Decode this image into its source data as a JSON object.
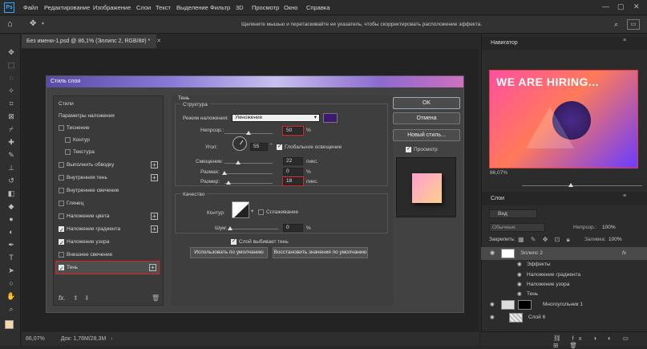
{
  "menu": [
    "Файл",
    "Редактирование",
    "Изображение",
    "Слои",
    "Текст",
    "Выделение",
    "Фильтр",
    "3D",
    "Просмотр",
    "Окно",
    "Справка"
  ],
  "options_hint": "Щелкните мышью и перетаскивайте ее указатель, чтобы скорректировать расположение эффекта.",
  "doc_tab": "Без имени-1.psd @ 86,1% (Эллипс 2, RGB/8#) *",
  "status": {
    "zoom": "86,07%",
    "doc": "Док: 1,76М/28,3M"
  },
  "navigator": {
    "title": "Навигатор",
    "thumb_text": "WE ARE HIRING...",
    "zoom": "86,07%"
  },
  "layers_panel": {
    "title": "Слои",
    "kind": "Вид",
    "blend": "Обычные",
    "opacity_label": "Непрозр.:",
    "opacity": "100%",
    "lock_label": "Закрепить:",
    "fill_label": "Заливка:",
    "fill": "100%",
    "layers": [
      "Эллипс 2",
      "Эффекты",
      "Наложение градиента",
      "Наложение узора",
      "Тень",
      "Многоугольник 1",
      "Слой 6"
    ]
  },
  "dialog": {
    "title": "Стиль слоя",
    "styles": [
      "Стили",
      "Параметры наложения",
      "Тиснение",
      "Контур",
      "Текстура",
      "Выполнить обводку",
      "Внутренняя тень",
      "Внутреннее свечение",
      "Глянец",
      "Наложение цвета",
      "Наложение градиента",
      "Наложение узора",
      "Внешнее свечение",
      "Тень"
    ],
    "section": "Тень",
    "structure": "Структура",
    "blend_mode_label": "Режим наложения:",
    "blend_mode": "Умножение",
    "shadow_color": "#3d1a6e",
    "opacity_label": "Непрозр.:",
    "opacity": "50",
    "angle_label": "Угол:",
    "angle": "55",
    "global_light": "Глобальное освещение",
    "distance_label": "Смещение:",
    "distance": "22",
    "spread_label": "Размах:",
    "spread": "0",
    "size_label": "Размер:",
    "size": "18",
    "unit_px": "пикс.",
    "unit_pct": "%",
    "unit_deg": "°",
    "quality": "Качество",
    "contour_label": "Контур:",
    "antialias": "Сглаживание",
    "noise_label": "Шум:",
    "noise": "0",
    "knockout": "Слой выбивает тень",
    "make_default": "Использовать по умолчанию",
    "reset_default": "Восстановить значения по умолчанию",
    "ok": "OK",
    "cancel": "Отмена",
    "new_style": "Новый стиль...",
    "preview": "Просмотр"
  }
}
